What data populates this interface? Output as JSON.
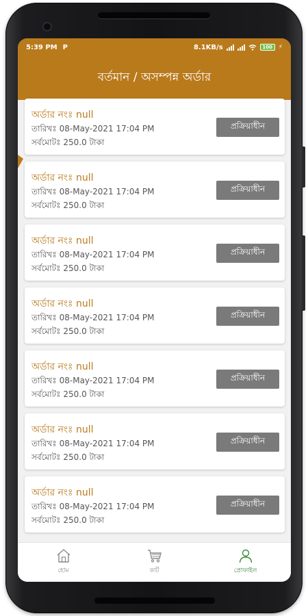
{
  "status_bar": {
    "time": "5:39 PM",
    "carrier_icon": "P",
    "network_speed": "8.1KB/s",
    "battery_level": "100"
  },
  "header": {
    "title": "বর্তমান / অসম্পন্ন অর্ডার"
  },
  "orders": [
    {
      "id_label": "অর্ডার নংঃ",
      "id_value": "null",
      "date_label": "তারিখঃ",
      "date": "08-May-2021 17:04 PM",
      "total_label": "সর্বমোটঃ",
      "total": "250.0 টাকা",
      "status": "প্রক্রিয়াধীন"
    },
    {
      "id_label": "অর্ডার নংঃ",
      "id_value": "null",
      "date_label": "তারিখঃ",
      "date": "08-May-2021 17:04 PM",
      "total_label": "সর্বমোটঃ",
      "total": "250.0 টাকা",
      "status": "প্রক্রিয়াধীন"
    },
    {
      "id_label": "অর্ডার নংঃ",
      "id_value": "null",
      "date_label": "তারিখঃ",
      "date": "08-May-2021 17:04 PM",
      "total_label": "সর্বমোটঃ",
      "total": "250.0 টাকা",
      "status": "প্রক্রিয়াধীন"
    },
    {
      "id_label": "অর্ডার নংঃ",
      "id_value": "null",
      "date_label": "তারিখঃ",
      "date": "08-May-2021 17:04 PM",
      "total_label": "সর্বমোটঃ",
      "total": "250.0 টাকা",
      "status": "প্রক্রিয়াধীন"
    },
    {
      "id_label": "অর্ডার নংঃ",
      "id_value": "null",
      "date_label": "তারিখঃ",
      "date": "08-May-2021 17:04 PM",
      "total_label": "সর্বমোটঃ",
      "total": "250.0 টাকা",
      "status": "প্রক্রিয়াধীন"
    },
    {
      "id_label": "অর্ডার নংঃ",
      "id_value": "null",
      "date_label": "তারিখঃ",
      "date": "08-May-2021 17:04 PM",
      "total_label": "সর্বমোটঃ",
      "total": "250.0 টাকা",
      "status": "প্রক্রিয়াধীন"
    },
    {
      "id_label": "অর্ডার নংঃ",
      "id_value": "null",
      "date_label": "তারিখঃ",
      "date": "08-May-2021 17:04 PM",
      "total_label": "সর্বমোটঃ",
      "total": "250.0 টাকা",
      "status": "প্রক্রিয়াধীন"
    }
  ],
  "nav": {
    "items": [
      {
        "label": "হোম",
        "icon": "home-icon",
        "active": false
      },
      {
        "label": "কার্ট",
        "icon": "cart-icon",
        "active": false
      },
      {
        "label": "প্রোফাইল",
        "icon": "profile-icon",
        "active": true
      }
    ]
  },
  "colors": {
    "brand": "#b97a1c",
    "status_button": "#7a7a7a",
    "nav_active": "#3a8a3a"
  }
}
